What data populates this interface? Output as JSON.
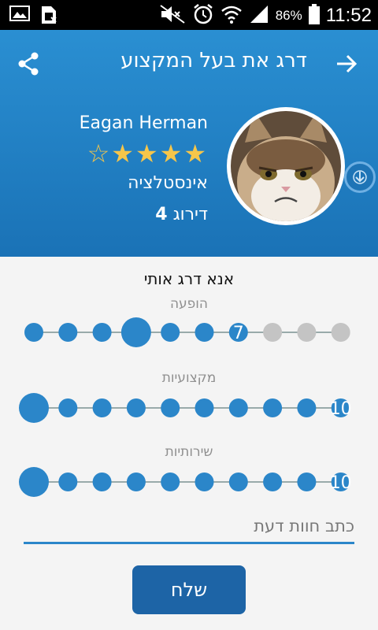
{
  "status_bar": {
    "battery_percent": "86%",
    "time": "11:52",
    "icons": [
      "image-icon",
      "sim-card-icon",
      "mute-icon",
      "alarm-icon",
      "wifi-icon",
      "signal-icon",
      "battery-icon"
    ]
  },
  "header": {
    "title": "דרג את בעל המקצוע",
    "share_icon": "share-icon",
    "back_icon": "arrow-right-icon"
  },
  "profile": {
    "name": "Eagan Herman",
    "stars_filled": 4,
    "stars_total": 5,
    "category": "אינסטלציה",
    "rating_label": "דירוג",
    "rating_value": "4"
  },
  "form": {
    "prompt": "אנא דרג אותי",
    "sliders": [
      {
        "label": "הופעה",
        "value": 7,
        "value_text": "7",
        "max": 10
      },
      {
        "label": "מקצועיות",
        "value": 10,
        "value_text": "10",
        "max": 10
      },
      {
        "label": "שירותיות",
        "value": 10,
        "value_text": "10",
        "max": 10
      }
    ],
    "comment_placeholder": "כתב חוות דעת",
    "send_label": "שלח"
  },
  "colors": {
    "header_top": "#2a8fd2",
    "header_bottom": "#1a72b6",
    "accent": "#2b86c9",
    "inactive_dot": "#c4c4c4",
    "star": "#f6c64a",
    "button": "#1d64a6"
  }
}
